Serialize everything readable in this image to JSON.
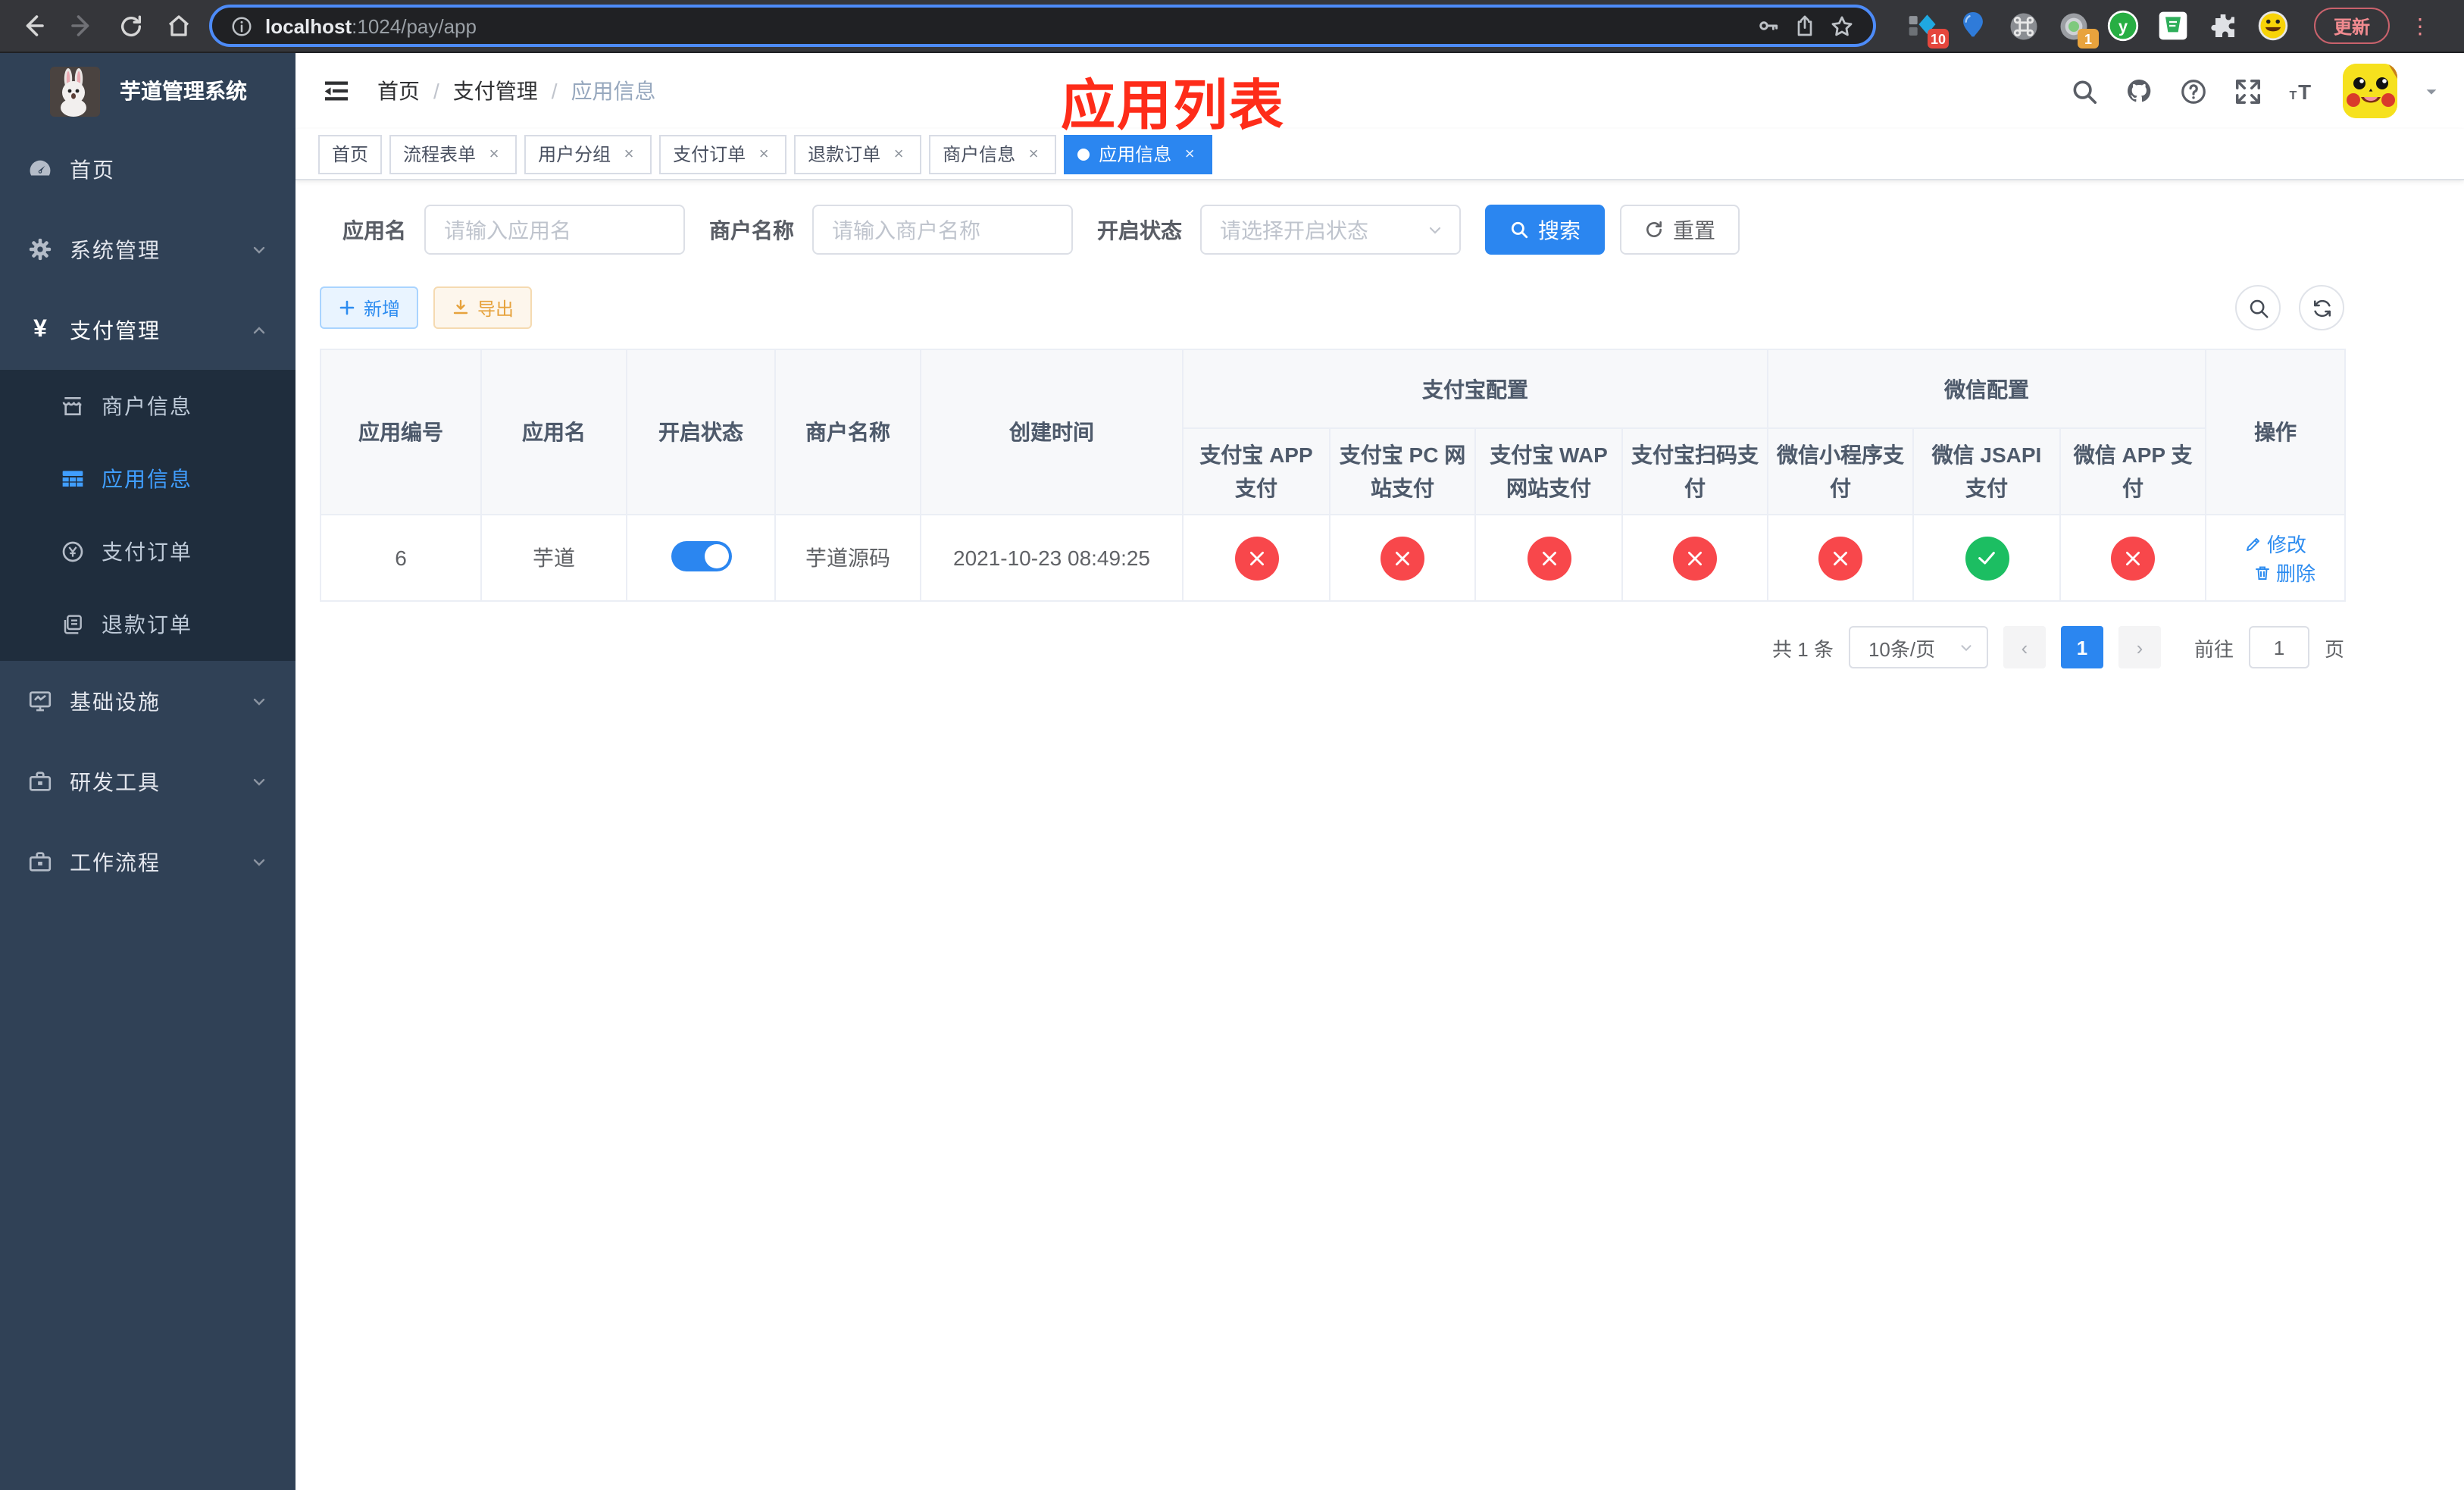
{
  "colors": {
    "primary": "#2b86f0",
    "sidebar_bg": "#304156",
    "submenu_bg": "#1f2d3d",
    "sidebar_active": "#409eff",
    "danger_circle": "#f8474b",
    "success_circle": "#1cbe62",
    "annotation_red": "#fe2c19",
    "export_yellow": "#e6a23c",
    "url_focus_border": "#4d8bf8"
  },
  "browser": {
    "url_host": "localhost",
    "url_rest": ":1024/pay/app",
    "ext_badge_blue": "10",
    "ext_badge_record": "1",
    "update_label": "更新",
    "kebab": "⋮"
  },
  "sidebar": {
    "title": "芋道管理系统",
    "home": "首页",
    "system": "系统管理",
    "payment": "支付管理",
    "merchant": "商户信息",
    "app_info": "应用信息",
    "pay_order": "支付订单",
    "refund_order": "退款订单",
    "infra": "基础设施",
    "dev_tools": "研发工具",
    "workflow": "工作流程"
  },
  "header": {
    "breadcrumb": [
      "首页",
      "支付管理",
      "应用信息"
    ],
    "sep": "/",
    "annotation": "应用列表"
  },
  "tabs": [
    {
      "label": "首页"
    },
    {
      "label": "流程表单",
      "close": "×"
    },
    {
      "label": "用户分组",
      "close": "×"
    },
    {
      "label": "支付订单",
      "close": "×"
    },
    {
      "label": "退款订单",
      "close": "×"
    },
    {
      "label": "商户信息",
      "close": "×"
    },
    {
      "label": "应用信息",
      "close": "×"
    }
  ],
  "filters": {
    "app_name_label": "应用名",
    "app_name_placeholder": "请输入应用名",
    "merchant_label": "商户名称",
    "merchant_placeholder": "请输入商户名称",
    "status_label": "开启状态",
    "status_placeholder": "请选择开启状态",
    "search_label": "搜索",
    "reset_label": "重置"
  },
  "toolbar": {
    "add_label": "新增",
    "export_label": "导出"
  },
  "table": {
    "groups": {
      "alipay": "支付宝配置",
      "wechat": "微信配置"
    },
    "headers": {
      "id": "应用编号",
      "name": "应用名",
      "status": "开启状态",
      "merchant": "商户名称",
      "created": "创建时间",
      "alipay_app": "支付宝 APP 支付",
      "alipay_pc": "支付宝 PC 网站支付",
      "alipay_wap": "支付宝 WAP 网站支付",
      "alipay_qr": "支付宝扫码支付",
      "wechat_mini": "微信小程序支付",
      "wechat_jsapi": "微信 JSAPI 支付",
      "wechat_app": "微信 APP 支付",
      "ops": "操作"
    },
    "rows": [
      {
        "id": "6",
        "name": "芋道",
        "enabled": "true",
        "merchant": "芋道源码",
        "created": "2021-10-23 08:49:25",
        "statuses": [
          "cross",
          "cross",
          "cross",
          "cross",
          "cross",
          "check",
          "cross"
        ],
        "edit_label": "修改",
        "delete_label": "删除"
      }
    ]
  },
  "pagination": {
    "total_text": "共 1 条",
    "page_size": "10条/页",
    "prev": "‹",
    "page": "1",
    "next": "›",
    "goto_label": "前往",
    "goto_value": "1",
    "goto_suffix": "页"
  }
}
